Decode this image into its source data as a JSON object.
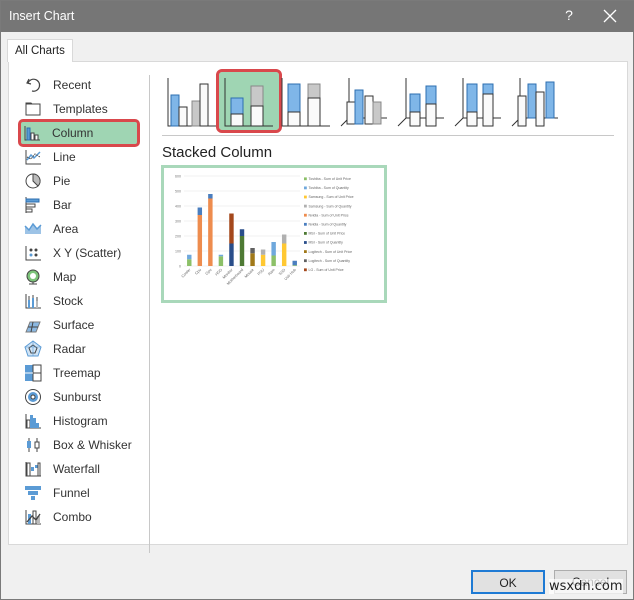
{
  "window": {
    "title": "Insert Chart",
    "help_label": "?",
    "close_icon": "close-icon"
  },
  "tabs": [
    {
      "label": "All Charts",
      "selected": true
    }
  ],
  "sidebar": {
    "items": [
      {
        "label": "Recent",
        "icon": "recent-icon"
      },
      {
        "label": "Templates",
        "icon": "templates-icon"
      },
      {
        "label": "Column",
        "icon": "column-chart-icon",
        "selected": true
      },
      {
        "label": "Line",
        "icon": "line-chart-icon"
      },
      {
        "label": "Pie",
        "icon": "pie-chart-icon"
      },
      {
        "label": "Bar",
        "icon": "bar-chart-icon"
      },
      {
        "label": "Area",
        "icon": "area-chart-icon"
      },
      {
        "label": "X Y (Scatter)",
        "icon": "scatter-chart-icon"
      },
      {
        "label": "Map",
        "icon": "map-chart-icon"
      },
      {
        "label": "Stock",
        "icon": "stock-chart-icon"
      },
      {
        "label": "Surface",
        "icon": "surface-chart-icon"
      },
      {
        "label": "Radar",
        "icon": "radar-chart-icon"
      },
      {
        "label": "Treemap",
        "icon": "treemap-chart-icon"
      },
      {
        "label": "Sunburst",
        "icon": "sunburst-chart-icon"
      },
      {
        "label": "Histogram",
        "icon": "histogram-chart-icon"
      },
      {
        "label": "Box & Whisker",
        "icon": "box-whisker-chart-icon"
      },
      {
        "label": "Waterfall",
        "icon": "waterfall-chart-icon"
      },
      {
        "label": "Funnel",
        "icon": "funnel-chart-icon"
      },
      {
        "label": "Combo",
        "icon": "combo-chart-icon"
      }
    ]
  },
  "subtypes": [
    {
      "name": "Clustered Column",
      "icon": "clustered-column-icon"
    },
    {
      "name": "Stacked Column",
      "icon": "stacked-column-icon",
      "selected": true
    },
    {
      "name": "100% Stacked Column",
      "icon": "100-stacked-column-icon"
    },
    {
      "name": "3-D Clustered Column",
      "icon": "3d-clustered-column-icon"
    },
    {
      "name": "3-D Stacked Column",
      "icon": "3d-stacked-column-icon"
    },
    {
      "name": "3-D 100% Stacked Column",
      "icon": "3d-100-stacked-column-icon"
    },
    {
      "name": "3-D Column",
      "icon": "3d-column-icon"
    }
  ],
  "selected_subtype_title": "Stacked Column",
  "buttons": {
    "ok": "OK",
    "cancel": "Cancel"
  },
  "watermark": "wsxdn.com",
  "colors": {
    "selection_fill": "#9fd5b3",
    "selection_border": "#d9484c",
    "titlebar": "#767676",
    "ok_border": "#1e7ad4",
    "icon_blue": "#5b9bd5"
  },
  "chart_data": {
    "type": "bar",
    "stacked": true,
    "title": "",
    "xlabel": "",
    "ylabel": "",
    "ylim": [
      0,
      600
    ],
    "yticks": [
      0,
      100,
      200,
      300,
      400,
      500,
      600
    ],
    "grid": true,
    "legend_position": "right",
    "categories": [
      "Cooler",
      "Cpu",
      "Gpu",
      "HDD",
      "Monitor",
      "Motherboard",
      "Mouse",
      "PSU",
      "Ram",
      "SSD",
      "Usb Hub"
    ],
    "series": [
      {
        "name": "Toshiba - Sum of Unit Price",
        "color": "#8cc068",
        "values": [
          45,
          0,
          0,
          65,
          0,
          0,
          0,
          0,
          70,
          0,
          5
        ]
      },
      {
        "name": "Toshiba - Sum of Quantity",
        "color": "#6fa8dc",
        "values": [
          30,
          0,
          0,
          10,
          0,
          0,
          0,
          0,
          90,
          0,
          0
        ]
      },
      {
        "name": "Samsung - Sum of Unit Price",
        "color": "#ffc832",
        "values": [
          0,
          0,
          0,
          0,
          0,
          0,
          0,
          75,
          0,
          150,
          0
        ]
      },
      {
        "name": "Samsung - Sum of Quantity",
        "color": "#b0b0b0",
        "values": [
          0,
          0,
          0,
          0,
          0,
          0,
          0,
          35,
          0,
          60,
          0
        ]
      },
      {
        "name": "Nvidia - Sum of Unit Price",
        "color": "#ee8c4e",
        "values": [
          0,
          340,
          450,
          0,
          0,
          0,
          0,
          0,
          0,
          0,
          0
        ]
      },
      {
        "name": "Nvidia - Sum of Quantity",
        "color": "#4a7ebf",
        "values": [
          0,
          50,
          30,
          0,
          0,
          0,
          0,
          0,
          0,
          0,
          30
        ]
      },
      {
        "name": "MSI - Sum of Unit Price",
        "color": "#4e7a34",
        "values": [
          0,
          0,
          0,
          0,
          0,
          200,
          0,
          0,
          0,
          0,
          0
        ]
      },
      {
        "name": "MSI - Sum of Quantity",
        "color": "#2a4e8a",
        "values": [
          0,
          0,
          0,
          0,
          150,
          45,
          0,
          0,
          0,
          0,
          0
        ]
      },
      {
        "name": "Logitech - Sum of Unit Price",
        "color": "#a07818",
        "values": [
          0,
          0,
          0,
          0,
          0,
          0,
          85,
          0,
          0,
          0,
          0
        ]
      },
      {
        "name": "Logitech - Sum of Quantity",
        "color": "#606060",
        "values": [
          0,
          0,
          0,
          0,
          0,
          0,
          35,
          0,
          0,
          0,
          0
        ]
      },
      {
        "name": "LG - Sum of Unit Price",
        "color": "#a4481c",
        "values": [
          0,
          0,
          0,
          0,
          200,
          0,
          0,
          0,
          0,
          0,
          0
        ]
      }
    ]
  }
}
